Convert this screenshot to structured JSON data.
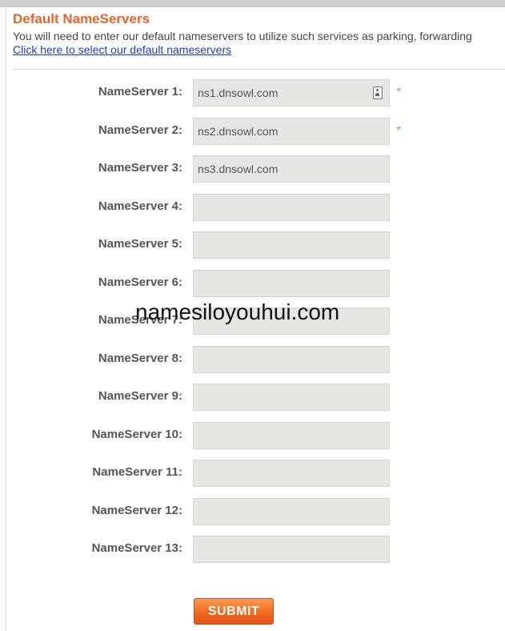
{
  "header": {
    "title": "Default NameServers",
    "description": "You will need to enter our default nameservers to utilize such services as parking, forwarding",
    "default_link": "Click here to select our default nameservers"
  },
  "form": {
    "required_marker": "*",
    "nameservers": [
      {
        "label": "NameServer 1:",
        "value": "ns1.dnsowl.com",
        "required": true
      },
      {
        "label": "NameServer 2:",
        "value": "ns2.dnsowl.com",
        "required": true
      },
      {
        "label": "NameServer 3:",
        "value": "ns3.dnsowl.com",
        "required": false
      },
      {
        "label": "NameServer 4:",
        "value": "",
        "required": false
      },
      {
        "label": "NameServer 5:",
        "value": "",
        "required": false
      },
      {
        "label": "NameServer 6:",
        "value": "",
        "required": false
      },
      {
        "label": "NameServer 7:",
        "value": "",
        "required": false
      },
      {
        "label": "NameServer 8:",
        "value": "",
        "required": false
      },
      {
        "label": "NameServer 9:",
        "value": "",
        "required": false
      },
      {
        "label": "NameServer 10:",
        "value": "",
        "required": false
      },
      {
        "label": "NameServer 11:",
        "value": "",
        "required": false
      },
      {
        "label": "NameServer 12:",
        "value": "",
        "required": false
      },
      {
        "label": "NameServer 13:",
        "value": "",
        "required": false
      }
    ],
    "submit_label": "SUBMIT"
  },
  "watermark": "namesiloyouhui.com",
  "colors": {
    "title": "#e8642c",
    "link": "#1a3fb5",
    "input_bg": "#e8e6e3",
    "submit": "#f06a1e",
    "required_marker": "#6aa6e0"
  }
}
